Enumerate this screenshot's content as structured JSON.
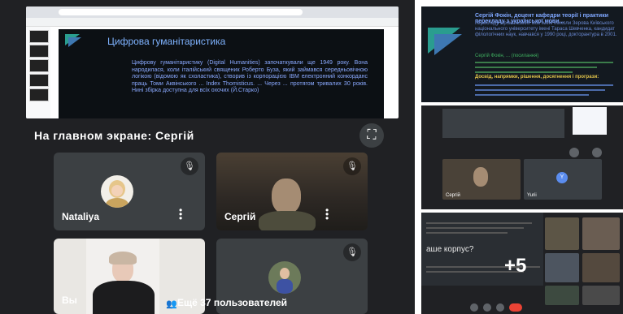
{
  "main_screen": {
    "label": "На главном экране: Сергій",
    "slide": {
      "title": "Цифрова гуманітаристика",
      "body": "Цифрову гуманітаристику (Digital Humanities) започаткували ще 1949 року. Вона народилася, коли італійський священик Роберто Буза, який займався середньовічною логікою (відомою як схоластика), створив із корпорацією IBM електронний конкорданс праць Томи Аквінського ... Index Thomisticus. ... Через ... протягом тривалих 30 років. Нині збірка доступна для всіх охочих (Й.Старко)"
    }
  },
  "participants": [
    {
      "name": "Nataliya"
    },
    {
      "name": "Сергій"
    },
    {
      "name": "Вы"
    }
  ],
  "more_participants": "Ещё 37 пользователей",
  "right_panels": {
    "top": {
      "title": "Сергій Фокін, доцент кафедри теорії і практики перекладу з української мови...",
      "text": "перекладу з романських мов імені Миколи Зерова Київського національного університету імені Тараса Шевченка, кандидат філологічних наук, навчався у 1990 році, докторантура в 2001.",
      "green": "Сергій Фокін, ... (посилання)",
      "yellow": "Досвід, напрямки, рішення, досягнення і програзи:"
    },
    "middle": {
      "names": [
        "Сергій",
        "Yurii"
      ]
    },
    "bottom": {
      "text": "аше корпус?",
      "overflow_count": "+5"
    }
  },
  "colors": {
    "meet_bg": "#202124",
    "tile_bg": "#3c4043",
    "slide_bg": "#0c1014",
    "slide_title": "#7fb3ff",
    "end_call": "#ea4335"
  },
  "icons": [
    "fullscreen-icon",
    "mic-off-icon",
    "more-vert-icon",
    "participants-icon"
  ]
}
